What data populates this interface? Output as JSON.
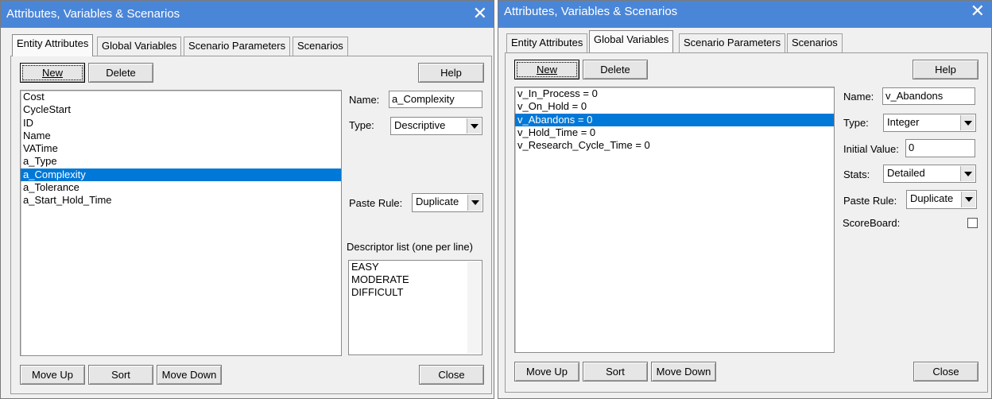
{
  "left": {
    "title": "Attributes, Variables & Scenarios",
    "close_glyph": "✕",
    "tabs": [
      "Entity Attributes",
      "Global Variables",
      "Scenario Parameters",
      "Scenarios"
    ],
    "selected_tab": "Entity Attributes",
    "buttons": {
      "new": "New",
      "delete": "Delete",
      "help": "Help",
      "move_up": "Move Up",
      "sort": "Sort",
      "move_down": "Move Down",
      "close": "Close"
    },
    "list_items": [
      "Cost",
      "CycleStart",
      "ID",
      "Name",
      "VATime",
      "a_Type",
      "a_Complexity",
      "a_Tolerance",
      "a_Start_Hold_Time"
    ],
    "selected_item": "a_Complexity",
    "name_label": "Name:",
    "name_value": "a_Complexity",
    "type_label": "Type:",
    "type_value": "Descriptive",
    "paste_rule_label": "Paste Rule:",
    "paste_rule_value": "Duplicate",
    "descriptor_label": "Descriptor list (one per line)",
    "descriptors": [
      "EASY",
      "MODERATE",
      "DIFFICULT"
    ]
  },
  "right": {
    "title": "Attributes, Variables & Scenarios",
    "close_glyph": "✕",
    "tabs": [
      "Entity Attributes",
      "Global Variables",
      "Scenario Parameters",
      "Scenarios"
    ],
    "selected_tab": "Global Variables",
    "buttons": {
      "new": "New",
      "delete": "Delete",
      "help": "Help",
      "move_up": "Move Up",
      "sort": "Sort",
      "move_down": "Move Down",
      "close": "Close"
    },
    "list_items": [
      "v_In_Process = 0",
      "v_On_Hold = 0",
      "v_Abandons = 0",
      "v_Hold_Time = 0",
      "v_Research_Cycle_Time = 0"
    ],
    "selected_item": "v_Abandons = 0",
    "name_label": "Name:",
    "name_value": "v_Abandons",
    "type_label": "Type:",
    "type_value": "Integer",
    "initial_value_label": "Initial Value:",
    "initial_value": "0",
    "stats_label": "Stats:",
    "stats_value": "Detailed",
    "paste_rule_label": "Paste Rule:",
    "paste_rule_value": "Duplicate",
    "scoreboard_label": "ScoreBoard:",
    "scoreboard_checked": false
  },
  "colors": {
    "titlebar": "#4a86d8",
    "selection": "#0078d7",
    "face": "#f0f0f0"
  }
}
